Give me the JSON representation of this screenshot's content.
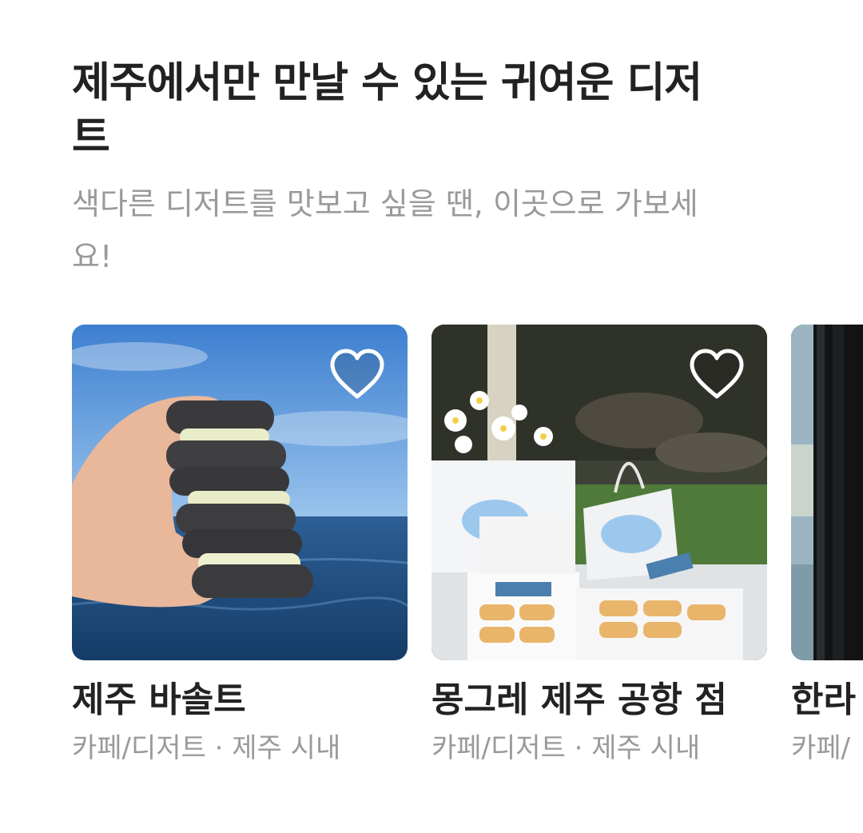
{
  "section": {
    "title": "제주에서만 만날 수 있는 귀여운 디저트",
    "subtitle": "색다른 디저트를 맛보고 싶을 땐, 이곳으로 가보세요!"
  },
  "cards": [
    {
      "name": "제주 바솔트",
      "category": "카페/디저트",
      "separator": "·",
      "location": "제주 시내",
      "icon": "heart-outline-icon"
    },
    {
      "name": "몽그레 제주 공항 점",
      "category": "카페/디저트",
      "separator": "·",
      "location": "제주 시내",
      "icon": "heart-outline-icon"
    },
    {
      "name": "한라",
      "category": "카페/",
      "icon": "heart-outline-icon"
    }
  ],
  "colors": {
    "title": "#222222",
    "secondary_text": "#9a9a9a",
    "background": "#ffffff"
  }
}
